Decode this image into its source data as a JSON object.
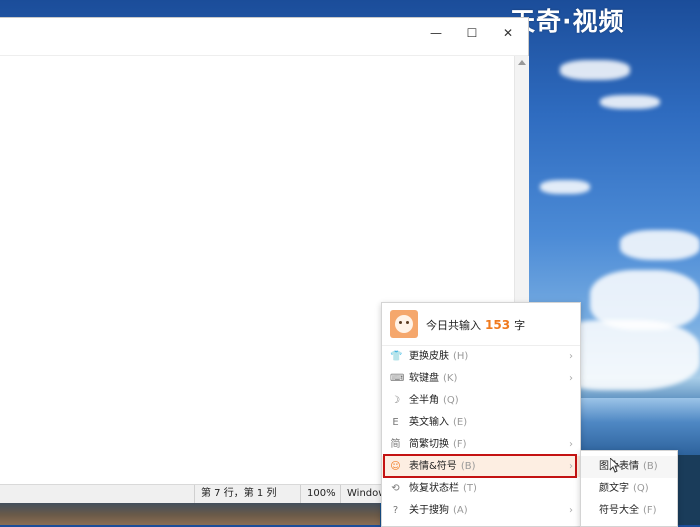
{
  "watermark": "天奇·视频",
  "window": {
    "controls": {
      "minimize": "—",
      "maximize": "☐",
      "close": "✕"
    }
  },
  "statusbar": {
    "position": "第 7 行，第 1 列",
    "zoom": "100%",
    "line_ending": "Window"
  },
  "ime_menu": {
    "header": {
      "prefix": "今日共输入",
      "count": "153",
      "suffix": "字"
    },
    "items": [
      {
        "label": "更换皮肤",
        "key": "(H)",
        "icon": "shirt-icon",
        "submenu": true
      },
      {
        "label": "软键盘",
        "key": "(K)",
        "icon": "keyboard-icon",
        "submenu": true
      },
      {
        "label": "全半角",
        "key": "(Q)",
        "icon": "moon-icon",
        "submenu": false
      },
      {
        "label": "英文输入",
        "key": "(E)",
        "icon": "english-icon",
        "submenu": false
      },
      {
        "label": "简繁切换",
        "key": "(F)",
        "icon": "traditional-icon",
        "submenu": true
      },
      {
        "label": "表情&符号",
        "key": "(B)",
        "icon": "smiley-icon",
        "submenu": true
      },
      {
        "label": "恢复状态栏",
        "key": "(T)",
        "icon": "restore-icon",
        "submenu": false
      },
      {
        "label": "关于搜狗",
        "key": "(A)",
        "icon": "help-icon",
        "submenu": true
      }
    ]
  },
  "submenu": {
    "items": [
      {
        "label": "图片表情",
        "key": "(B)"
      },
      {
        "label": "颜文字",
        "key": "(Q)"
      },
      {
        "label": "符号大全",
        "key": "(F)"
      }
    ]
  }
}
